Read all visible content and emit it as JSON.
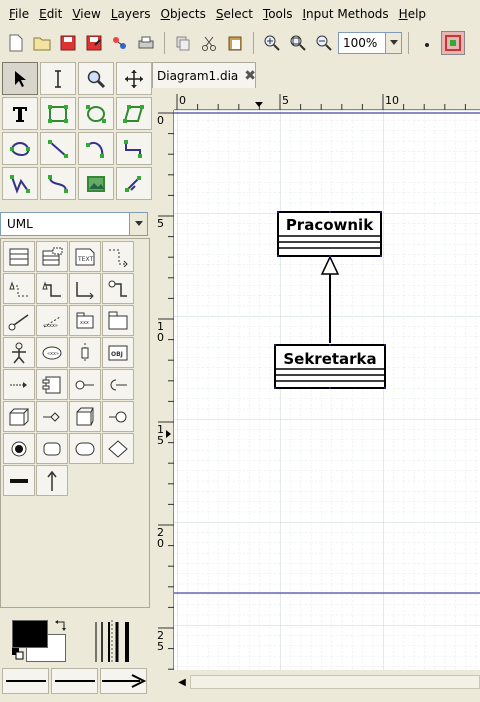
{
  "menu": [
    {
      "label": "File",
      "u": "F",
      "rest": "ile"
    },
    {
      "label": "Edit",
      "u": "E",
      "rest": "dit"
    },
    {
      "label": "View",
      "u": "V",
      "rest": "iew"
    },
    {
      "label": "Layers",
      "u": "L",
      "rest": "ayers"
    },
    {
      "label": "Objects",
      "u": "O",
      "rest": "bjects"
    },
    {
      "label": "Select",
      "u": "S",
      "rest": "elect"
    },
    {
      "label": "Tools",
      "u": "T",
      "rest": "ools"
    },
    {
      "label": "Input Methods",
      "u": "I",
      "rest": "nput Methods"
    },
    {
      "label": "Help",
      "u": "H",
      "rest": "elp"
    }
  ],
  "toolbar": {
    "zoom_value": "100%"
  },
  "sheet": {
    "selected": "UML"
  },
  "tab": {
    "title": "Diagram1.dia"
  },
  "ruler": {
    "top_labels": [
      "0",
      "5",
      "10"
    ],
    "left_labels": [
      "0",
      "5",
      "10",
      "15",
      "20",
      "25"
    ]
  },
  "diagram": {
    "classes": [
      {
        "name": "Pracownik"
      },
      {
        "name": "Sekretarka"
      }
    ]
  },
  "colors": {
    "foreground": "#000000",
    "background": "#ffffff",
    "page_border": "#000080"
  }
}
